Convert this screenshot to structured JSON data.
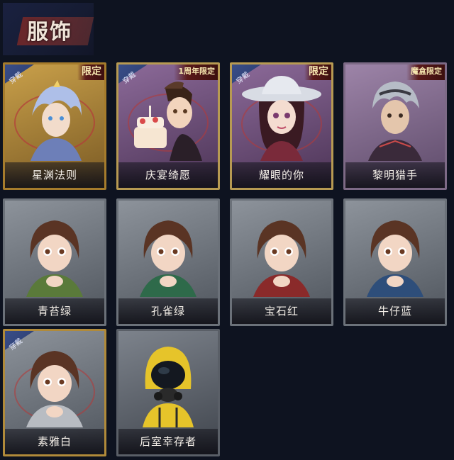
{
  "header": {
    "title": "服饰"
  },
  "cards": [
    {
      "name": "星渊法则",
      "wearing": true,
      "limit": "限定",
      "style": "gold",
      "art": "blue-hair-mage"
    },
    {
      "name": "庆宴绮愿",
      "wearing": true,
      "limit": "1周年限定",
      "style": "purple",
      "art": "cake-girl"
    },
    {
      "name": "耀眼的你",
      "wearing": true,
      "limit": "限定",
      "style": "purple",
      "art": "cowboy-hat-girl"
    },
    {
      "name": "黎明猎手",
      "wearing": false,
      "limit": "魔盒限定",
      "style": "purple2",
      "art": "silver-hair-hunter"
    },
    {
      "name": "青苔绿",
      "wearing": false,
      "limit": "",
      "style": "gray",
      "art": "girl-green"
    },
    {
      "name": "孔雀绿",
      "wearing": false,
      "limit": "",
      "style": "gray",
      "art": "girl-teal"
    },
    {
      "name": "宝石红",
      "wearing": false,
      "limit": "",
      "style": "gray",
      "art": "girl-red"
    },
    {
      "name": "牛仔蓝",
      "wearing": false,
      "limit": "",
      "style": "gray",
      "art": "girl-blue"
    },
    {
      "name": "素雅白",
      "wearing": true,
      "limit": "",
      "style": "gray-gold",
      "art": "girl-white"
    },
    {
      "name": "后室幸存者",
      "wearing": false,
      "limit": "",
      "style": "dark",
      "art": "hazmat-survivor"
    }
  ],
  "wear_label": "穿戴",
  "colors": {
    "background": "#0e1320",
    "wear_tag": "#3a4f8a",
    "limit_text": "#f7e7b0"
  }
}
